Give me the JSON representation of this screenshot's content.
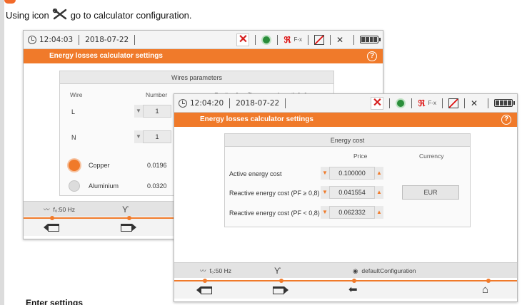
{
  "instruction": {
    "prefix": "Using icon",
    "suffix": "go to calculator configuration."
  },
  "footer_heading": "Enter settings",
  "screen1": {
    "time": "12:04:03",
    "date": "2018-07-22",
    "fx_label": "F-x",
    "title": "Energy losses calculator settings",
    "panel_title": "Wires parameters",
    "columns": {
      "wire": "Wire",
      "number": "Number",
      "section": "Section [mm²]",
      "length": "Length [m]"
    },
    "rows": [
      {
        "label": "L",
        "number": "1"
      },
      {
        "label": "N",
        "number": "1"
      }
    ],
    "materials": [
      {
        "label": "Copper",
        "value": "0.0196",
        "selected": true
      },
      {
        "label": "Aluminium",
        "value": "0.0320",
        "selected": false
      }
    ],
    "frequency": "f₀:50 Hz"
  },
  "screen2": {
    "time": "12:04:20",
    "date": "2018-07-22",
    "fx_label": "F-x",
    "title": "Energy losses calculator settings",
    "panel_title": "Energy cost",
    "price_header": "Price",
    "currency_header": "Currency",
    "rows": [
      {
        "label": "Active energy cost",
        "value": "0.100000"
      },
      {
        "label": "Reactive energy cost (PF ≥ 0,8)",
        "value": "0.041554"
      },
      {
        "label": "Reactive energy cost (PF < 0,8)",
        "value": "0.062332"
      }
    ],
    "currency": "EUR",
    "frequency": "f₀:50 Hz",
    "configuration": "defaultConfiguration"
  },
  "colors": {
    "accent": "#f07a2a",
    "close": "#d61f1f",
    "record": "#2a8d3a"
  }
}
